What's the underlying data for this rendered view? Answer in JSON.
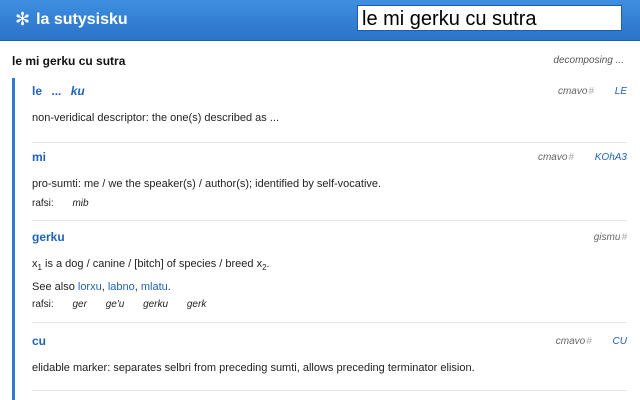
{
  "header": {
    "brand": "la sutysisku",
    "search_value": "le mi gerku cu sutra"
  },
  "query": {
    "text": "le mi gerku cu sutra",
    "status": "decomposing ..."
  },
  "entries": [
    {
      "word": "le",
      "dots": "...",
      "terminator": "ku",
      "type": "cmavo",
      "selmaho": "LE",
      "definition": "non-veridical descriptor: the one(s) described as ..."
    },
    {
      "word": "mi",
      "type": "cmavo",
      "selmaho": "KOhA3",
      "definition": "pro-sumti: me / we the speaker(s) / author(s); identified by self-vocative.",
      "rafsi_label": "rafsi:",
      "rafsi": [
        "mib"
      ]
    },
    {
      "word": "gerku",
      "type": "gismu",
      "definition_parts": [
        "x",
        "1",
        " is a dog / canine / [bitch] of species / breed x",
        "2",
        "."
      ],
      "see_also_label": "See also",
      "see_also": [
        "lorxu",
        "labno",
        "mlatu"
      ],
      "rafsi_label": "rafsi:",
      "rafsi": [
        "ger",
        "ge'u",
        "gerku",
        "gerk"
      ]
    },
    {
      "word": "cu",
      "type": "cmavo",
      "selmaho": "CU",
      "definition": "elidable marker: separates selbri from preceding sumti, allows preceding terminator elision."
    }
  ],
  "icons": {
    "brand": "asterisk-icon",
    "permalink": "hash-icon"
  },
  "colors": {
    "header": "#2f7ad6",
    "link": "#1f62b8"
  }
}
